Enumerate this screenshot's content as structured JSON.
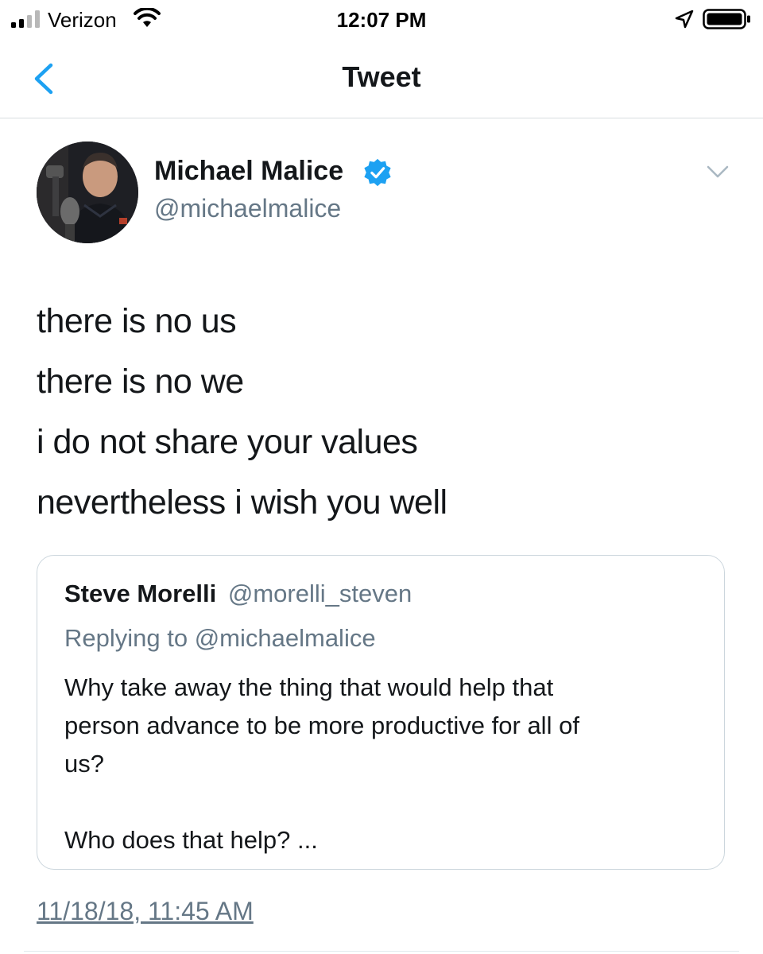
{
  "status_bar": {
    "carrier": "Verizon",
    "time": "12:07 PM",
    "icons": [
      "signal-icon",
      "wifi-icon",
      "location-icon",
      "battery-icon"
    ]
  },
  "nav": {
    "title": "Tweet",
    "back_icon": "chevron-left-icon"
  },
  "tweet": {
    "author_name": "Michael Malice",
    "author_handle": "@michaelmalice",
    "verified": true,
    "lines": [
      "there is no us",
      "there is no we",
      "i do not share your values",
      "nevertheless i wish you well"
    ],
    "timestamp": "11/18/18, 11:45 AM"
  },
  "quoted_tweet": {
    "author_name": "Steve Morelli",
    "author_handle": "@morelli_steven",
    "replying_to": "Replying to @michaelmalice",
    "lines": [
      "Why take away the thing that would help that",
      "person advance to be more productive for all of",
      "us?",
      "",
      "Who does that help? ..."
    ]
  },
  "colors": {
    "accent": "#1da1f2",
    "text": "#14171a",
    "secondary": "#657786",
    "border": "#ccd6dd"
  }
}
